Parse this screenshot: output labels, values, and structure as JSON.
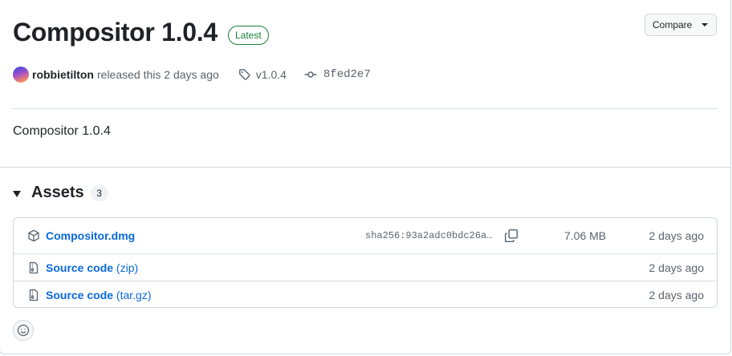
{
  "release": {
    "title": "Compositor 1.0.4",
    "badge": "Latest",
    "compare_label": "Compare",
    "author": "robbietilton",
    "released_text": "released this 2 days ago",
    "tag": "v1.0.4",
    "commit": "8fed2e7",
    "body": "Compositor 1.0.4"
  },
  "assets": {
    "title": "Assets",
    "count": "3",
    "items": [
      {
        "name": "Compositor.dmg",
        "suffix": "",
        "sha": "sha256:93a2adc0bdc26a…",
        "size": "7.06 MB",
        "date": "2 days ago",
        "icon": "package-icon"
      },
      {
        "name": "Source code",
        "suffix": " (zip)",
        "sha": "",
        "size": "",
        "date": "2 days ago",
        "icon": "file-zip-icon"
      },
      {
        "name": "Source code",
        "suffix": " (tar.gz)",
        "sha": "",
        "size": "",
        "date": "2 days ago",
        "icon": "file-zip-icon"
      }
    ]
  },
  "colors": {
    "accent_link": "#0969da",
    "latest_green": "#1a7f37",
    "border": "#d0d7de",
    "muted_text": "#59636e"
  }
}
